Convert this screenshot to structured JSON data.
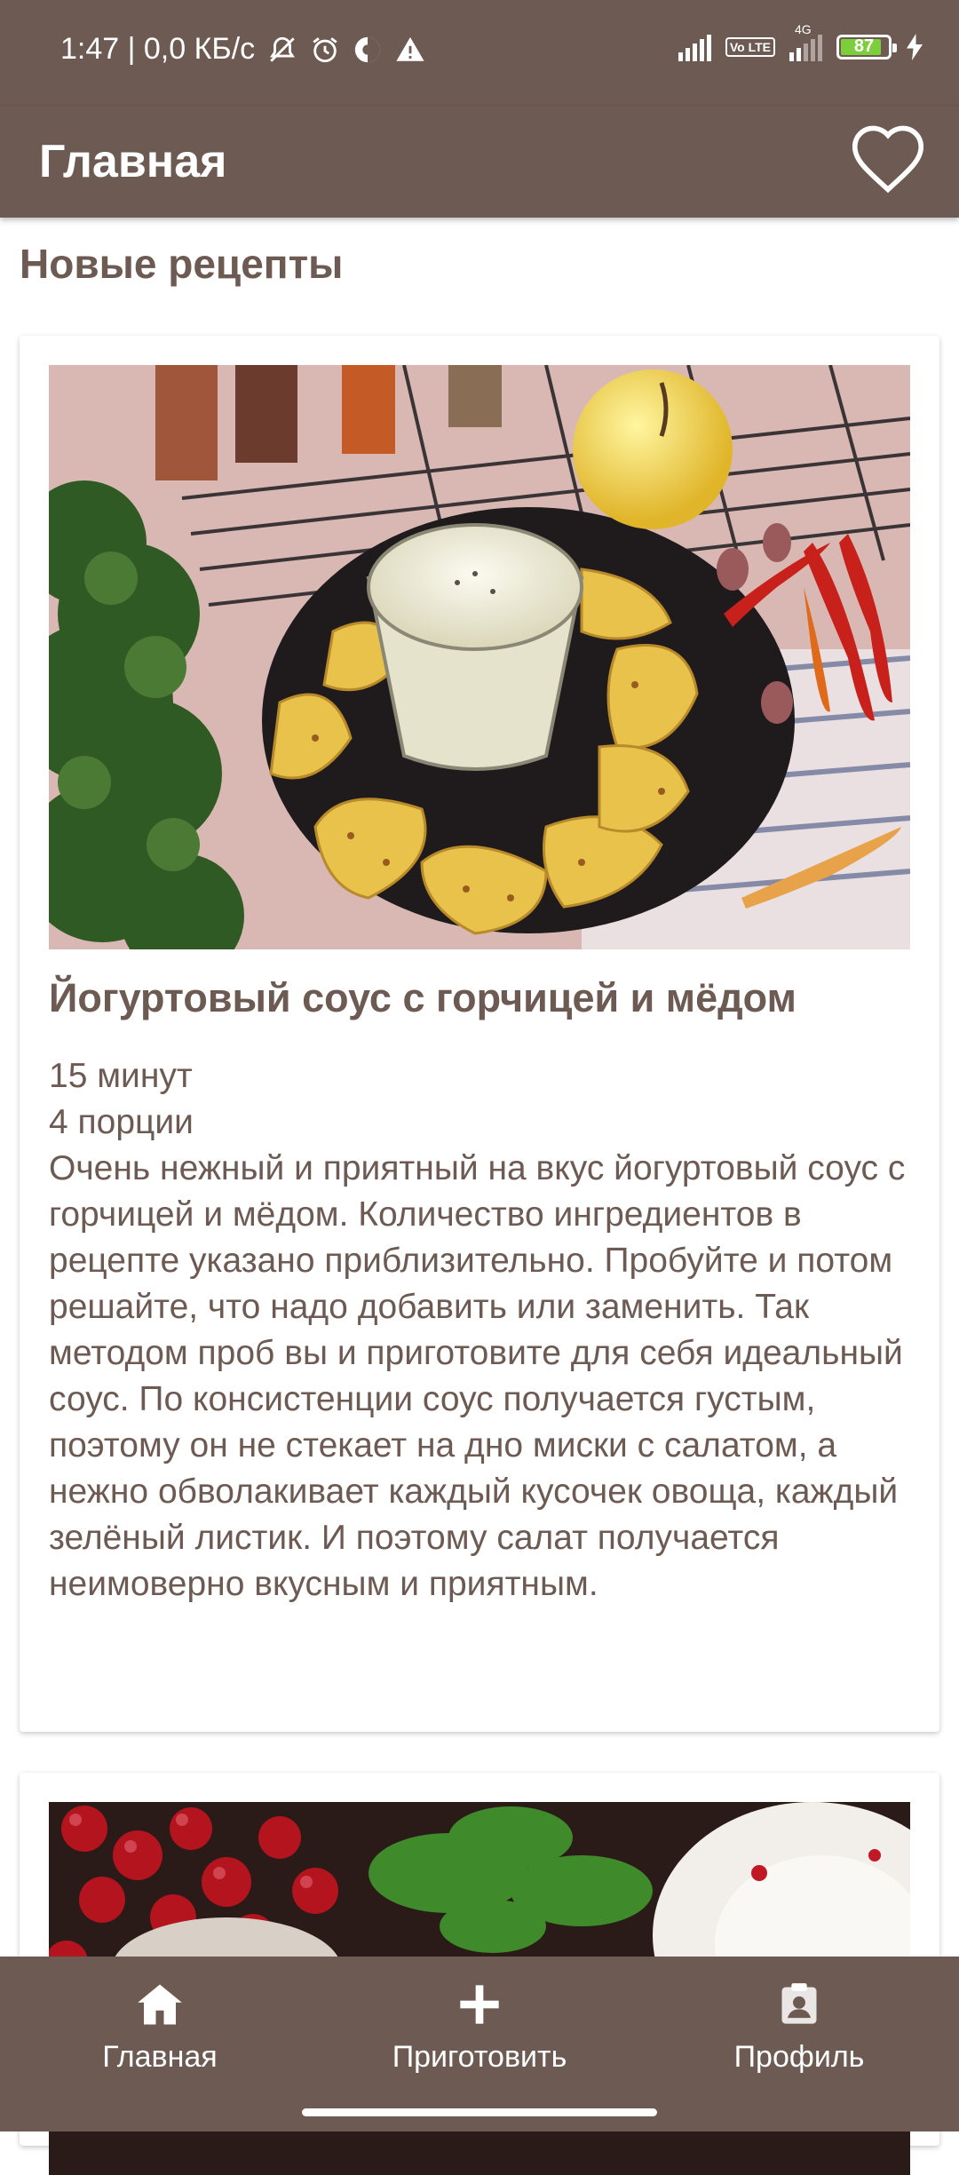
{
  "status_bar": {
    "time_info": "1:47 | 0,0 КБ/с",
    "network": "4G",
    "volte": "Vo LTE",
    "battery": "87"
  },
  "app_bar": {
    "title": "Главная",
    "favorite_icon": "heart-outline-icon"
  },
  "section": {
    "title": "Новые рецепты"
  },
  "recipes": [
    {
      "title": "Йогуртовый соус с горчицей и мёдом",
      "time": "15 минут",
      "portions": "4 порции",
      "description": "Очень нежный и приятный на вкус йогуртовый соус с горчицей и мёдом. Количество ингредиентов в рецепте указано приблизительно. Пробуйте и потом решайте, что надо добавить или заменить. Так методом проб вы и приготовите для себя идеальный соус. По консистенции соус получается густым, поэтому он не стекает на дно миски с салатом, а нежно обволакивает каждый кусочек овоща, каждый зелёный листик. И поэтому салат получается неимоверно вкусным и приятным."
    }
  ],
  "bottom_nav": {
    "items": [
      {
        "label": "Главная",
        "icon": "home-icon"
      },
      {
        "label": "Приготовить",
        "icon": "plus-icon"
      },
      {
        "label": "Профиль",
        "icon": "profile-icon"
      }
    ]
  },
  "colors": {
    "primary": "#6d5a52",
    "text": "#6d5a52",
    "background": "#ffffff"
  }
}
